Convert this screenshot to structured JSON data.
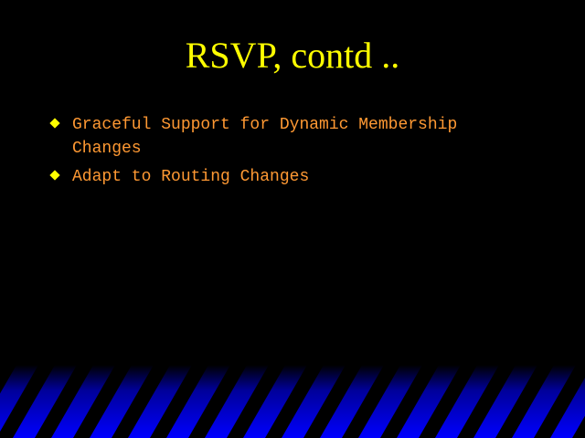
{
  "slide": {
    "title": "RSVP, contd ..",
    "title_color": "#ffff00",
    "text_color": "#ff9933",
    "background_color": "#000000",
    "bullets": [
      {
        "line1": "Graceful Support for Dynamic Membership",
        "line2": "Changes"
      },
      {
        "line1": "Adapt to Routing Changes"
      }
    ],
    "bullet_icon": "diamond-icon",
    "footer": {
      "gradient_top": "#000000",
      "gradient_bottom": "#0000ff",
      "stripe_color": "#000000"
    }
  }
}
